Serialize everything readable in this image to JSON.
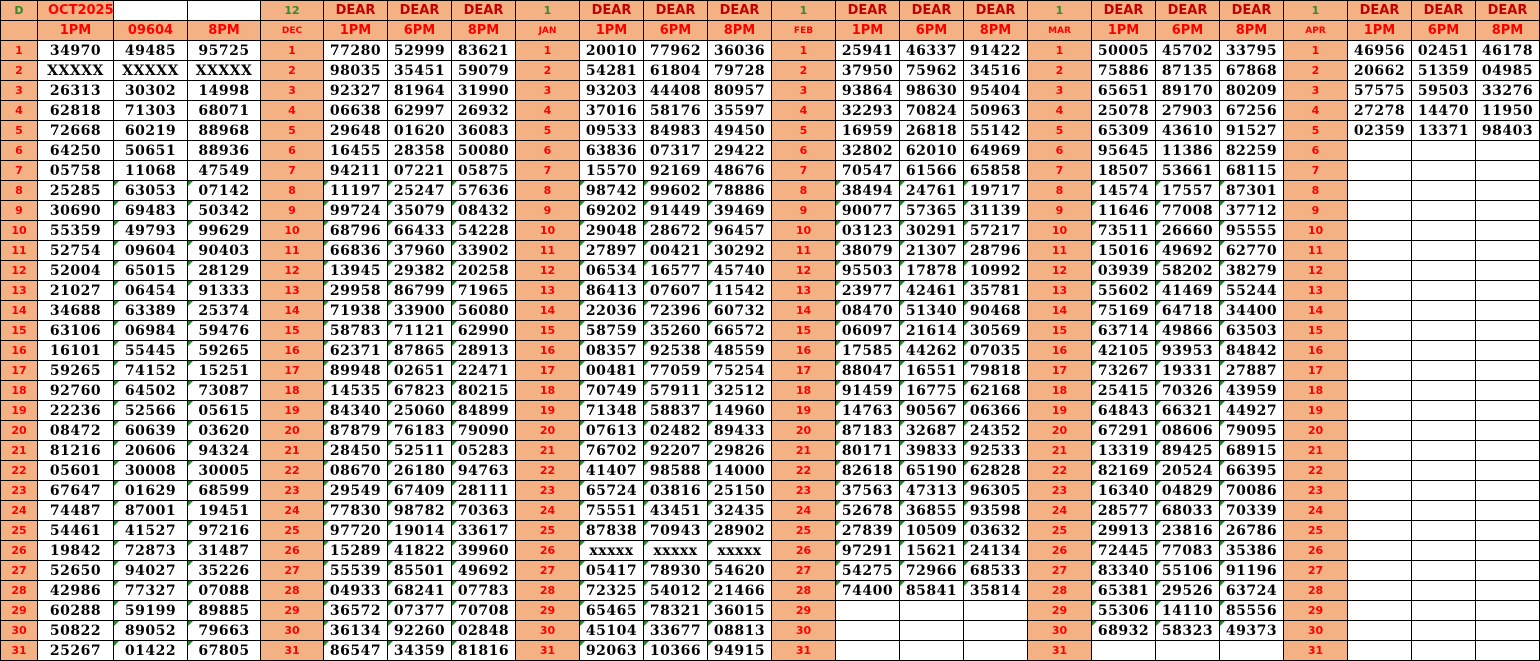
{
  "columns": [
    {
      "label": "D",
      "date": "OCT2025"
    },
    {
      "label": "12",
      "month": "DEC"
    },
    {
      "label": "1",
      "month": "JAN"
    },
    {
      "label": "1",
      "month": "FEB"
    },
    {
      "label": "1",
      "month": "MAR"
    },
    {
      "label": "1",
      "month": "APR"
    }
  ],
  "header": {
    "d": "D",
    "oct": "OCT2025",
    "oct_mid": "09604",
    "dear": "DEAR",
    "p1": "1PM",
    "p6": "6PM",
    "p8": "8PM",
    "dec_num": "12",
    "jan_num": "1",
    "feb_num": "1",
    "mar_num": "1",
    "apr_num": "1",
    "dec": "DEC",
    "jan": "JAN",
    "feb": "FEB",
    "mar": "MAR",
    "apr": "APR"
  },
  "months": [
    {
      "name": "OCT",
      "rows": [
        [
          "34970",
          "49485",
          "95725"
        ],
        [
          "XXXXX",
          "XXXXX",
          "XXXXX"
        ],
        [
          "26313",
          "30302",
          "14998"
        ],
        [
          "62818",
          "71303",
          "68071"
        ],
        [
          "72668",
          "60219",
          "88968"
        ],
        [
          "64250",
          "50651",
          "88936"
        ],
        [
          "05758",
          "11068",
          "47549"
        ],
        [
          "25285",
          "63053",
          "07142"
        ],
        [
          "30690",
          "69483",
          "50342"
        ],
        [
          "55359",
          "49793",
          "99629"
        ],
        [
          "52754",
          "09604",
          "90403"
        ],
        [
          "52004",
          "65015",
          "28129"
        ],
        [
          "21027",
          "06454",
          "91333"
        ],
        [
          "34688",
          "63389",
          "25374"
        ],
        [
          "63106",
          "06984",
          "59476"
        ],
        [
          "16101",
          "55445",
          "59265"
        ],
        [
          "59265",
          "74152",
          "15251"
        ],
        [
          "92760",
          "64502",
          "73087"
        ],
        [
          "22236",
          "52566",
          "05615"
        ],
        [
          "08472",
          "60639",
          "03620"
        ],
        [
          "81216",
          "20606",
          "94324"
        ],
        [
          "05601",
          "30008",
          "30005"
        ],
        [
          "67647",
          "01629",
          "68599"
        ],
        [
          "74487",
          "87001",
          "19451"
        ],
        [
          "54461",
          "41527",
          "97216"
        ],
        [
          "19842",
          "72873",
          "31487"
        ],
        [
          "52650",
          "94027",
          "35226"
        ],
        [
          "42986",
          "77327",
          "07088"
        ],
        [
          "60288",
          "59199",
          "89885"
        ],
        [
          "50822",
          "89052",
          "79663"
        ],
        [
          "25267",
          "01422",
          "67805"
        ]
      ]
    },
    {
      "name": "DEC",
      "rows": [
        [
          "77280",
          "52999",
          "83621"
        ],
        [
          "98035",
          "35451",
          "59079"
        ],
        [
          "92327",
          "81964",
          "31990"
        ],
        [
          "06638",
          "62997",
          "26932"
        ],
        [
          "29648",
          "01620",
          "36083"
        ],
        [
          "16455",
          "28358",
          "50080"
        ],
        [
          "94211",
          "07221",
          "05875"
        ],
        [
          "11197",
          "25247",
          "57636"
        ],
        [
          "99724",
          "35079",
          "08432"
        ],
        [
          "68796",
          "66433",
          "54228"
        ],
        [
          "66836",
          "37960",
          "33902"
        ],
        [
          "13945",
          "29382",
          "20258"
        ],
        [
          "29958",
          "86799",
          "71965"
        ],
        [
          "71938",
          "33900",
          "56080"
        ],
        [
          "58783",
          "71121",
          "62990"
        ],
        [
          "62371",
          "87865",
          "28913"
        ],
        [
          "89948",
          "02651",
          "22471"
        ],
        [
          "14535",
          "67823",
          "80215"
        ],
        [
          "84340",
          "25060",
          "84899"
        ],
        [
          "87879",
          "76183",
          "79090"
        ],
        [
          "28450",
          "52511",
          "05283"
        ],
        [
          "08670",
          "26180",
          "94763"
        ],
        [
          "29549",
          "67409",
          "28111"
        ],
        [
          "77830",
          "98782",
          "70363"
        ],
        [
          "97720",
          "19014",
          "33617"
        ],
        [
          "15289",
          "41822",
          "39960"
        ],
        [
          "55539",
          "85501",
          "49692"
        ],
        [
          "04933",
          "68241",
          "07783"
        ],
        [
          "36572",
          "07377",
          "70708"
        ],
        [
          "36134",
          "92260",
          "02848"
        ],
        [
          "86547",
          "34359",
          "81816"
        ]
      ]
    },
    {
      "name": "JAN",
      "rows": [
        [
          "20010",
          "77962",
          "36036"
        ],
        [
          "54281",
          "61804",
          "79728"
        ],
        [
          "93203",
          "44408",
          "80957"
        ],
        [
          "37016",
          "58176",
          "35597"
        ],
        [
          "09533",
          "84983",
          "49450"
        ],
        [
          "63836",
          "07317",
          "29422"
        ],
        [
          "15570",
          "92169",
          "48676"
        ],
        [
          "98742",
          "99602",
          "78886"
        ],
        [
          "69202",
          "91449",
          "39469"
        ],
        [
          "29048",
          "28672",
          "96457"
        ],
        [
          "27897",
          "00421",
          "30292"
        ],
        [
          "06534",
          "16577",
          "45740"
        ],
        [
          "86413",
          "07607",
          "11542"
        ],
        [
          "22036",
          "72396",
          "60732"
        ],
        [
          "58759",
          "35260",
          "66572"
        ],
        [
          "08357",
          "92538",
          "48559"
        ],
        [
          "00481",
          "77059",
          "75254"
        ],
        [
          "70749",
          "57911",
          "32512"
        ],
        [
          "71348",
          "58837",
          "14960"
        ],
        [
          "07613",
          "02482",
          "89433"
        ],
        [
          "76702",
          "92207",
          "29826"
        ],
        [
          "41407",
          "98588",
          "14000"
        ],
        [
          "65724",
          "03816",
          "25150"
        ],
        [
          "75551",
          "43451",
          "32435"
        ],
        [
          "87838",
          "70943",
          "28902"
        ],
        [
          "xxxxx",
          "xxxxx",
          "xxxxx"
        ],
        [
          "05417",
          "78930",
          "54620"
        ],
        [
          "72325",
          "54012",
          "21466"
        ],
        [
          "65465",
          "78321",
          "36015"
        ],
        [
          "45104",
          "33677",
          "08813"
        ],
        [
          "92063",
          "10366",
          "94915"
        ]
      ]
    },
    {
      "name": "FEB",
      "rows": [
        [
          "25941",
          "46337",
          "91422"
        ],
        [
          "37950",
          "75962",
          "34516"
        ],
        [
          "93864",
          "98630",
          "95404"
        ],
        [
          "32293",
          "70824",
          "50963"
        ],
        [
          "16959",
          "26818",
          "55142"
        ],
        [
          "32802",
          "62010",
          "64969"
        ],
        [
          "70547",
          "61566",
          "65858"
        ],
        [
          "38494",
          "24761",
          "19717"
        ],
        [
          "90077",
          "57365",
          "31139"
        ],
        [
          "03123",
          "30291",
          "57217"
        ],
        [
          "38079",
          "21307",
          "28796"
        ],
        [
          "95503",
          "17878",
          "10992"
        ],
        [
          "23977",
          "42461",
          "35781"
        ],
        [
          "08470",
          "51340",
          "90468"
        ],
        [
          "06097",
          "21614",
          "30569"
        ],
        [
          "17585",
          "44262",
          "07035"
        ],
        [
          "88047",
          "16551",
          "79818"
        ],
        [
          "91459",
          "16775",
          "62168"
        ],
        [
          "14763",
          "90567",
          "06366"
        ],
        [
          "87183",
          "32687",
          "24352"
        ],
        [
          "80171",
          "39833",
          "92533"
        ],
        [
          "82618",
          "65190",
          "62828"
        ],
        [
          "37563",
          "47313",
          "96305"
        ],
        [
          "52678",
          "36855",
          "93598"
        ],
        [
          "27839",
          "10509",
          "03632"
        ],
        [
          "97291",
          "15621",
          "24134"
        ],
        [
          "54275",
          "72966",
          "68533"
        ],
        [
          "74400",
          "85841",
          "35814"
        ],
        [
          "",
          "",
          ""
        ],
        [
          "",
          "",
          ""
        ],
        [
          "",
          "",
          ""
        ]
      ]
    },
    {
      "name": "MAR",
      "rows": [
        [
          "50005",
          "45702",
          "33795"
        ],
        [
          "75886",
          "87135",
          "67868"
        ],
        [
          "65651",
          "89170",
          "80209"
        ],
        [
          "25078",
          "27903",
          "67256"
        ],
        [
          "65309",
          "43610",
          "91527"
        ],
        [
          "95645",
          "11386",
          "82259"
        ],
        [
          "18507",
          "53661",
          "68115"
        ],
        [
          "14574",
          "17557",
          "87301"
        ],
        [
          "11646",
          "77008",
          "37712"
        ],
        [
          "73511",
          "26660",
          "95555"
        ],
        [
          "15016",
          "49692",
          "62770"
        ],
        [
          "03939",
          "58202",
          "38279"
        ],
        [
          "55602",
          "41469",
          "55244"
        ],
        [
          "75169",
          "64718",
          "34400"
        ],
        [
          "63714",
          "49866",
          "63503"
        ],
        [
          "42105",
          "93953",
          "84842"
        ],
        [
          "73267",
          "19331",
          "27887"
        ],
        [
          "25415",
          "70326",
          "43959"
        ],
        [
          "64843",
          "66321",
          "44927"
        ],
        [
          "67291",
          "08606",
          "79095"
        ],
        [
          "13319",
          "89425",
          "68915"
        ],
        [
          "82169",
          "20524",
          "66395"
        ],
        [
          "16340",
          "04829",
          "70086"
        ],
        [
          "28577",
          "68033",
          "70339"
        ],
        [
          "29913",
          "23816",
          "26786"
        ],
        [
          "72445",
          "77083",
          "35386"
        ],
        [
          "83340",
          "55106",
          "91196"
        ],
        [
          "65381",
          "29526",
          "63724"
        ],
        [
          "55306",
          "14110",
          "85556"
        ],
        [
          "68932",
          "58323",
          "49373"
        ],
        [
          "",
          "",
          ""
        ]
      ]
    },
    {
      "name": "APR",
      "rows": [
        [
          "46956",
          "02451",
          "46178"
        ],
        [
          "20662",
          "51359",
          "04985"
        ],
        [
          "57575",
          "59503",
          "33276"
        ],
        [
          "27278",
          "14470",
          "11950"
        ],
        [
          "02359",
          "13371",
          "98403"
        ],
        [
          "",
          "",
          ""
        ],
        [
          "",
          "",
          ""
        ],
        [
          "",
          "",
          ""
        ],
        [
          "",
          "",
          ""
        ],
        [
          "",
          "",
          ""
        ],
        [
          "",
          "",
          ""
        ],
        [
          "",
          "",
          ""
        ],
        [
          "",
          "",
          ""
        ],
        [
          "",
          "",
          ""
        ],
        [
          "",
          "",
          ""
        ],
        [
          "",
          "",
          ""
        ],
        [
          "",
          "",
          ""
        ],
        [
          "",
          "",
          ""
        ],
        [
          "",
          "",
          ""
        ],
        [
          "",
          "",
          ""
        ],
        [
          "",
          "",
          ""
        ],
        [
          "",
          "",
          ""
        ],
        [
          "",
          "",
          ""
        ],
        [
          "",
          "",
          ""
        ],
        [
          "",
          "",
          ""
        ],
        [
          "",
          "",
          ""
        ],
        [
          "",
          "",
          ""
        ],
        [
          "",
          "",
          ""
        ],
        [
          "",
          "",
          ""
        ],
        [
          "",
          "",
          ""
        ],
        [
          "",
          "",
          ""
        ]
      ]
    }
  ],
  "day_numbers": [
    "1",
    "2",
    "3",
    "4",
    "5",
    "6",
    "7",
    "8",
    "9",
    "10",
    "11",
    "12",
    "13",
    "14",
    "15",
    "16",
    "17",
    "18",
    "19",
    "20",
    "21",
    "22",
    "23",
    "24",
    "25",
    "26",
    "27",
    "28",
    "29",
    "30",
    "31"
  ]
}
